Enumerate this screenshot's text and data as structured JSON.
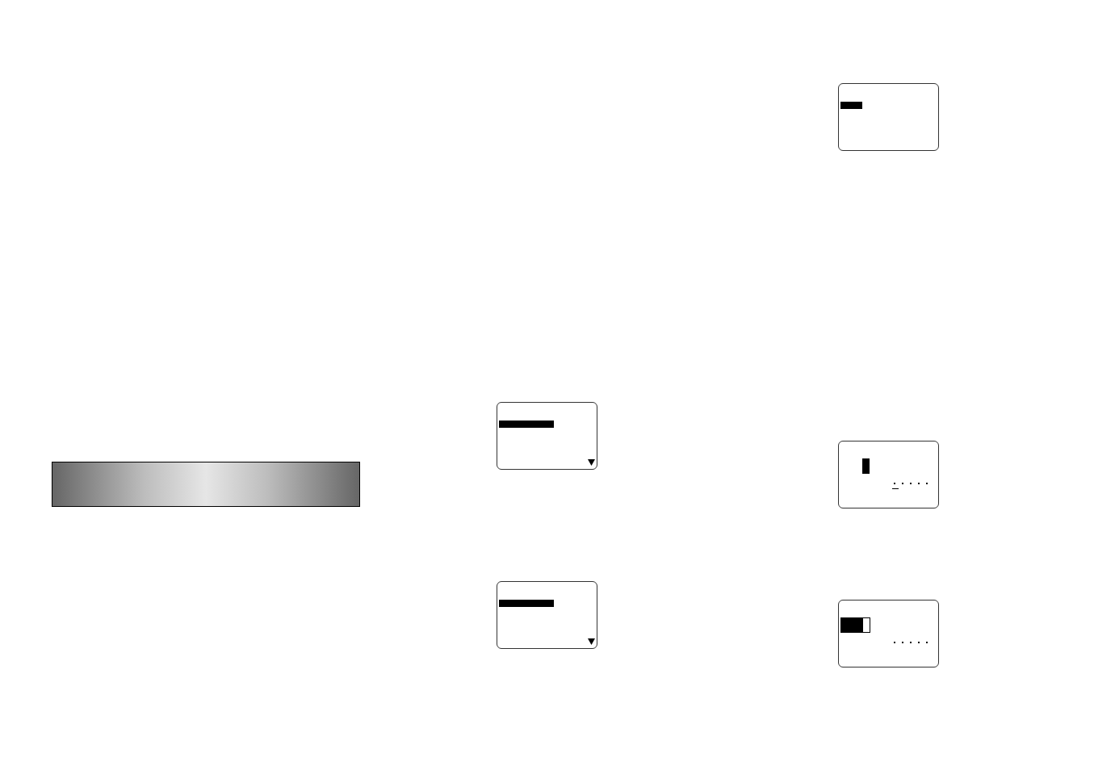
{
  "left_page": {
    "banner": {
      "kind": "gradient"
    },
    "screens": [
      {
        "kind": "menu",
        "more_below": true
      },
      {
        "kind": "menu",
        "more_below": true
      }
    ]
  },
  "right_page": {
    "screens": [
      {
        "kind": "prompt",
        "more_below": false
      },
      {
        "kind": "entry",
        "cursor": {
          "kind": "bar"
        },
        "underline": true,
        "more_below": false
      },
      {
        "kind": "entry",
        "cursor": {
          "kind": "block"
        },
        "underline": false,
        "more_below": false
      }
    ]
  }
}
